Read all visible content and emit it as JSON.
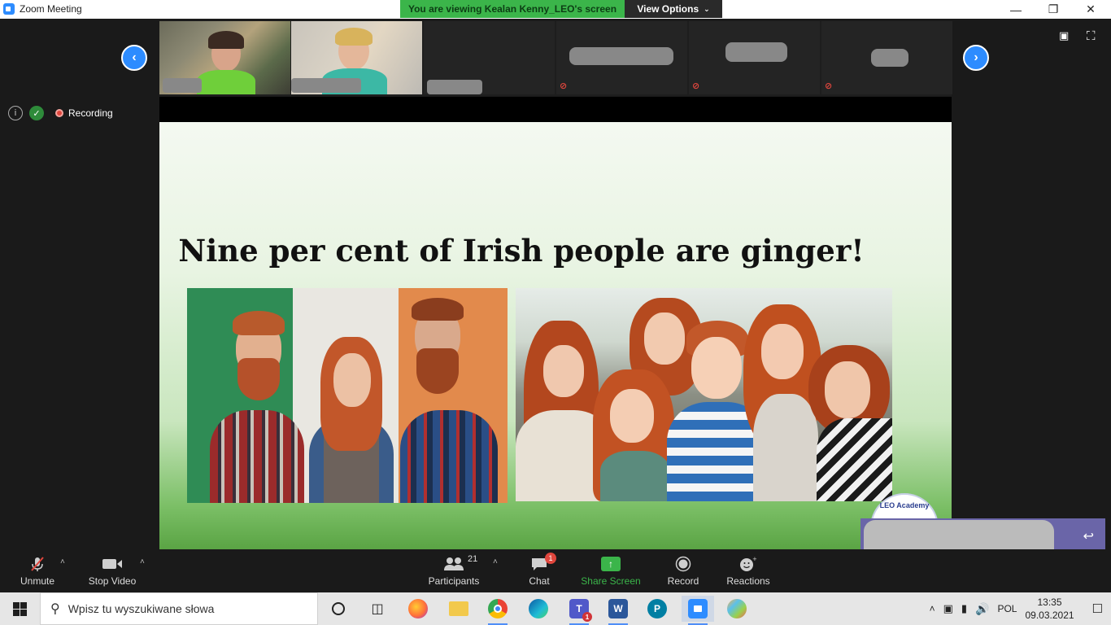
{
  "window": {
    "title": "Zoom Meeting",
    "viewing_banner": "You are viewing Kealan Kenny_LEO's screen",
    "view_options": "View Options"
  },
  "meeting": {
    "recording_label": "Recording"
  },
  "slide": {
    "title": "Nine per cent of Irish people are ginger!",
    "logo_text": "LEO Academy"
  },
  "toolbar": {
    "unmute": "Unmute",
    "stop_video": "Stop Video",
    "participants": "Participants",
    "participants_count": "21",
    "chat": "Chat",
    "chat_badge": "1",
    "share_screen": "Share Screen",
    "record": "Record",
    "reactions": "Reactions"
  },
  "taskbar": {
    "search_placeholder": "Wpisz tu wyszukiwane słowa",
    "language": "POL",
    "time": "13:35",
    "date": "09.03.2021",
    "teams_badge": "1"
  },
  "colors": {
    "zoom_blue": "#2D8CFF",
    "banner_green": "#3bb54a",
    "mute_red": "#e0463d"
  }
}
